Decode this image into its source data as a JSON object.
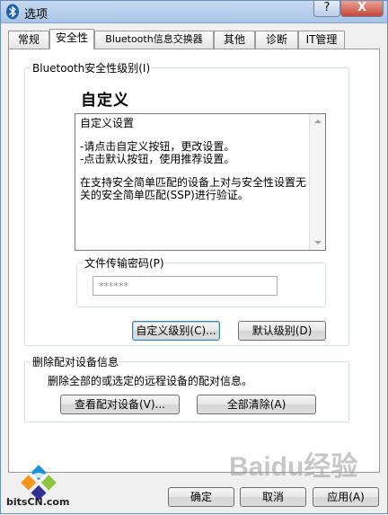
{
  "window": {
    "title": "选项",
    "help_label": "?",
    "close_label": "X"
  },
  "tabs": [
    {
      "label": "常规"
    },
    {
      "label": "安全性"
    },
    {
      "label": "Bluetooth信息交换器"
    },
    {
      "label": "其他"
    },
    {
      "label": "诊断"
    },
    {
      "label": "IT管理"
    }
  ],
  "security_level": {
    "group_label": "Bluetooth安全性级别(I)",
    "profile_name": "自定义",
    "description": [
      "自定义设置",
      "-请点击自定义按钮，更改设置。\n-点击默认按钮，使用推荐设置。",
      "在支持安全简单匹配的设备上对与安全性设置无关的安全简单匹配(SSP)进行验证。"
    ],
    "file_transfer_label": "文件传输密码(P)",
    "password_value": "******",
    "custom_level_button": "自定义级别(C)...",
    "default_level_button": "默认级别(D)"
  },
  "pairing": {
    "group_label": "删除配对设备信息",
    "description": "删除全部的或选定的远程设备的配对信息。",
    "view_button": "查看配对设备(V)...",
    "clear_button": "全部清除(A)"
  },
  "footer": {
    "ok_button": "确定",
    "cancel_button": "取消",
    "apply_button": "应用(A)"
  },
  "branding": {
    "logo_text": "bitsCN.com",
    "watermark_text": "Baidu经验"
  }
}
